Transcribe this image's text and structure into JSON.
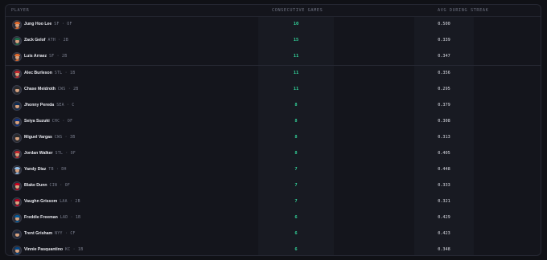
{
  "header": {
    "player": "PLAYER",
    "games": "CONSECUTIVE GAMES",
    "avg": "AVG DURING STREAK"
  },
  "colors": {
    "accent_green": "#32d39a"
  },
  "rows": [
    {
      "name": "Jung Hoo Lee",
      "team": "SF",
      "pos": "OF",
      "games": "10",
      "avg": "0.500",
      "team_color": "#e06a2c"
    },
    {
      "name": "Zack Gelof",
      "team": "ATH",
      "pos": "2B",
      "games": "15",
      "avg": "0.339",
      "team_color": "#1f6e4a"
    },
    {
      "name": "Luis Arraez",
      "team": "SF",
      "pos": "2B",
      "games": "11",
      "avg": "0.347",
      "team_color": "#e06a2c"
    },
    {
      "name": "Alec Burleson",
      "team": "STL",
      "pos": "1B",
      "games": "11",
      "avg": "0.356",
      "team_color": "#c0282f"
    },
    {
      "name": "Chase Meidroth",
      "team": "CWS",
      "pos": "2B",
      "games": "11",
      "avg": "0.295",
      "team_color": "#2a2a2a"
    },
    {
      "name": "Jhonny Pereda",
      "team": "SEA",
      "pos": "C",
      "games": "8",
      "avg": "0.379",
      "team_color": "#0c2c56"
    },
    {
      "name": "Seiya Suzuki",
      "team": "CHC",
      "pos": "OF",
      "games": "8",
      "avg": "0.308",
      "team_color": "#0e3386"
    },
    {
      "name": "Miguel Vargas",
      "team": "CWS",
      "pos": "3B",
      "games": "8",
      "avg": "0.313",
      "team_color": "#2a2a2a"
    },
    {
      "name": "Jordan Walker",
      "team": "STL",
      "pos": "OF",
      "games": "8",
      "avg": "0.405",
      "team_color": "#c0282f"
    },
    {
      "name": "Yandy Diaz",
      "team": "TB",
      "pos": "DH",
      "games": "7",
      "avg": "0.448",
      "team_color": "#8fbce6"
    },
    {
      "name": "Blake Dunn",
      "team": "CIN",
      "pos": "OF",
      "games": "7",
      "avg": "0.333",
      "team_color": "#c6011f"
    },
    {
      "name": "Vaughn Grissom",
      "team": "LAA",
      "pos": "2B",
      "games": "7",
      "avg": "0.321",
      "team_color": "#ba0021"
    },
    {
      "name": "Freddie Freeman",
      "team": "LAD",
      "pos": "1B",
      "games": "6",
      "avg": "0.429",
      "team_color": "#005a9c"
    },
    {
      "name": "Trent Grisham",
      "team": "NYY",
      "pos": "CF",
      "games": "6",
      "avg": "0.423",
      "team_color": "#1c2841"
    },
    {
      "name": "Vinnie Pasquantino",
      "team": "KC",
      "pos": "1B",
      "games": "6",
      "avg": "0.348",
      "team_color": "#004687"
    }
  ]
}
